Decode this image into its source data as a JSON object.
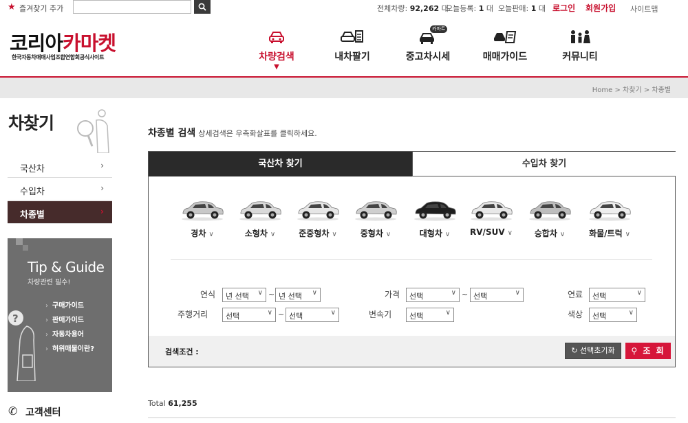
{
  "topbar": {
    "favorite_label": "즐겨찾기 추가",
    "search_placeholder": "",
    "stats": {
      "total_label": "전체차량:",
      "total_value": "92,262",
      "total_unit": "대",
      "today_reg_label": "오늘등록:",
      "today_reg_value": "1",
      "today_reg_unit": "대",
      "today_sale_label": "오늘판매:",
      "today_sale_value": "1",
      "today_sale_unit": "대"
    },
    "login": "로그인",
    "join": "회원가입",
    "sitemap": "사이트맵"
  },
  "logo": {
    "part1": "코리아",
    "part2": "카마켓",
    "subtitle": "한국자동차매매사업조합연합회공식사이트"
  },
  "nav": [
    {
      "label": "차량검색"
    },
    {
      "label": "내차팔기"
    },
    {
      "label": "중고차시세",
      "badge": "카마트"
    },
    {
      "label": "매매가이드"
    },
    {
      "label": "커뮤니티"
    }
  ],
  "breadcrumb": "Home > 차찾기 > 차종별",
  "sidebar": {
    "title": "차찾기",
    "items": [
      {
        "label": "국산차"
      },
      {
        "label": "수입차"
      },
      {
        "label": "차종별"
      }
    ],
    "tip": {
      "title": "Tip & Guide",
      "subtitle": "차량관련 필수!",
      "links": [
        "구매가이드",
        "판매가이드",
        "자동차용어",
        "허위매물이란?"
      ]
    },
    "customer_center": "고객센터"
  },
  "main": {
    "title": "차종별 검색",
    "subtitle": "상세검색은 우측화살표를 클릭하세요.",
    "tabs": [
      {
        "label": "국산차 찾기"
      },
      {
        "label": "수입차 찾기"
      }
    ],
    "car_types": [
      {
        "label": "경차",
        "color": "#c8c8c8"
      },
      {
        "label": "소형차",
        "color": "#d9d9d9"
      },
      {
        "label": "준중형차",
        "color": "#e6e6e6"
      },
      {
        "label": "중형차",
        "color": "#cfcfcf"
      },
      {
        "label": "대형차",
        "color": "#1f1f1f"
      },
      {
        "label": "RV/SUV",
        "color": "#e8e8e8"
      },
      {
        "label": "승합차",
        "color": "#bdbdbd"
      },
      {
        "label": "화물/트럭",
        "color": "#eeeeee"
      }
    ],
    "filters": {
      "year_label": "연식",
      "year_from": "년 선택",
      "year_to": "년 선택",
      "price_label": "가격",
      "price_from": "선택",
      "price_to": "선택",
      "fuel_label": "연료",
      "fuel": "선택",
      "mileage_label": "주행거리",
      "mileage_from": "선택",
      "mileage_to": "선택",
      "transmission_label": "변속기",
      "transmission": "선택",
      "color_label": "색상",
      "color": "선택"
    },
    "conditions_label": "검색조건 :",
    "reset_label": "선택초기화",
    "search_label": "조 회",
    "total_label": "Total",
    "total_value": "61,255"
  },
  "colors": {
    "accent": "#c8102e",
    "dark": "#2a2a2a",
    "sidebar_active": "#462b2b"
  }
}
